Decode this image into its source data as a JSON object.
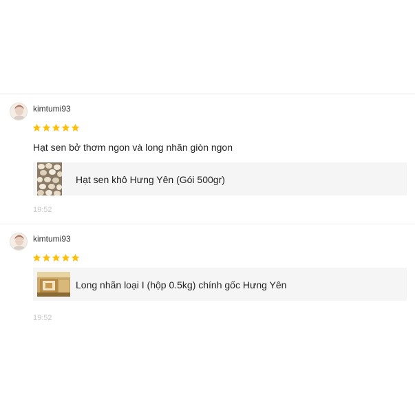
{
  "reviews": [
    {
      "username": "kimtumi93",
      "rating": 5,
      "comment": "Hạt sen bở thơm ngon và long nhãn giòn ngon",
      "product": {
        "name": "Hạt sen khô Hưng Yên (Gói 500gr)",
        "thumbnail_icon": "lotus-seeds-thumbnail"
      },
      "time": "19:52"
    },
    {
      "username": "kimtumi93",
      "rating": 5,
      "comment": "",
      "product": {
        "name": "Long nhãn loại I (hộp 0.5kg) chính gốc Hưng Yên",
        "thumbnail_icon": "dried-longan-box-thumbnail"
      },
      "time": "19:52"
    }
  ],
  "colors": {
    "star": "#fcbf10",
    "product_bg": "#f5f5f5",
    "time": "#c8c8c8"
  }
}
